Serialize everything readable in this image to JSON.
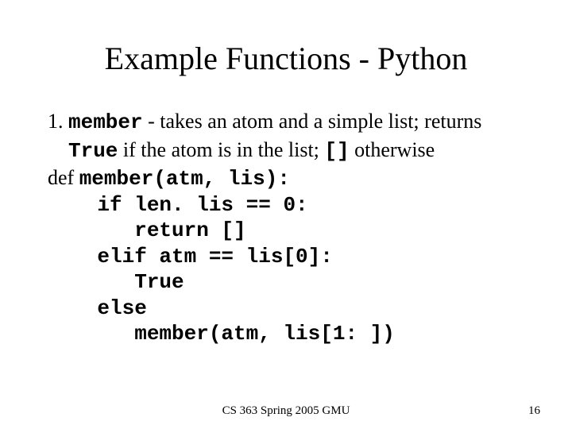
{
  "title": "Example Functions - Python",
  "item": {
    "num": "1. ",
    "kw1": "member",
    "desc1a": " - takes an atom and a simple list; returns ",
    "kw2": "True",
    "desc2a": " if the atom is in the list; ",
    "kw3": "[]",
    "desc2b": " otherwise"
  },
  "code": {
    "l1a": "def ",
    "l1b": "member(atm, lis):",
    "l2": "    if len. lis == 0:",
    "l3": "       return []",
    "l4": "    elif atm == lis[0]:",
    "l5": "       True",
    "l6": "    else",
    "l7": "       member(atm, lis[1: ])"
  },
  "footer": "CS 363 Spring 2005 GMU",
  "page": "16"
}
